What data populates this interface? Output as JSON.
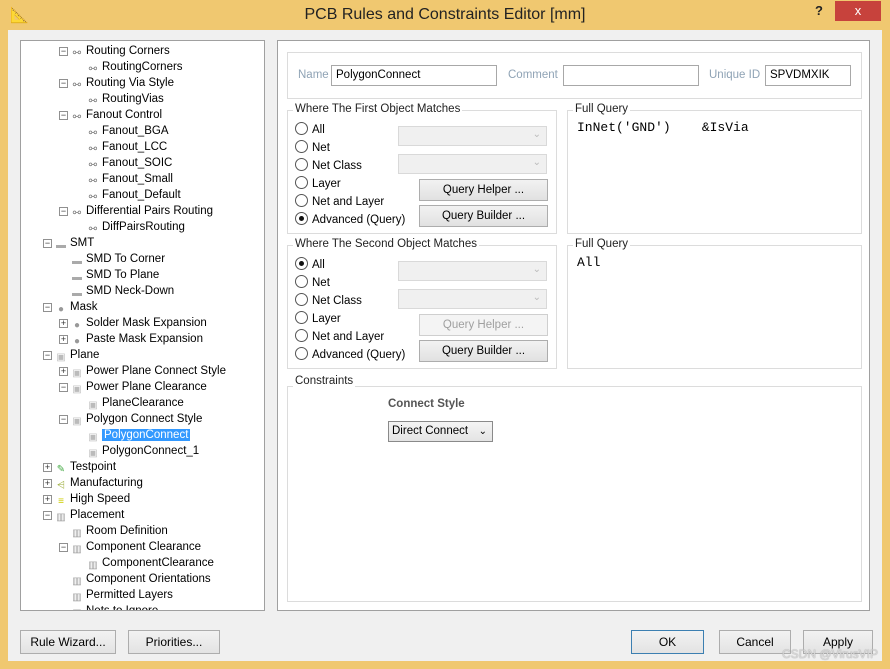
{
  "window": {
    "title": "PCB Rules and Constraints Editor [mm]",
    "help": "?",
    "close": "x"
  },
  "tree": [
    {
      "level": 2,
      "exp": "-",
      "icon": "routing",
      "label": "Routing Corners"
    },
    {
      "level": 3,
      "icon": "routing",
      "label": "RoutingCorners"
    },
    {
      "level": 2,
      "exp": "-",
      "icon": "routing",
      "label": "Routing Via Style"
    },
    {
      "level": 3,
      "icon": "routing",
      "label": "RoutingVias"
    },
    {
      "level": 2,
      "exp": "-",
      "icon": "routing",
      "label": "Fanout Control"
    },
    {
      "level": 3,
      "icon": "routing",
      "label": "Fanout_BGA"
    },
    {
      "level": 3,
      "icon": "routing",
      "label": "Fanout_LCC"
    },
    {
      "level": 3,
      "icon": "routing",
      "label": "Fanout_SOIC"
    },
    {
      "level": 3,
      "icon": "routing",
      "label": "Fanout_Small"
    },
    {
      "level": 3,
      "icon": "routing",
      "label": "Fanout_Default"
    },
    {
      "level": 2,
      "exp": "-",
      "icon": "routing",
      "label": "Differential Pairs Routing"
    },
    {
      "level": 3,
      "icon": "routing",
      "label": "DiffPairsRouting"
    },
    {
      "level": 1,
      "exp": "-",
      "icon": "smt",
      "label": "SMT"
    },
    {
      "level": 2,
      "icon": "smt",
      "label": "SMD To Corner"
    },
    {
      "level": 2,
      "icon": "smt",
      "label": "SMD To Plane"
    },
    {
      "level": 2,
      "icon": "smt",
      "label": "SMD Neck-Down"
    },
    {
      "level": 1,
      "exp": "-",
      "icon": "mask",
      "label": "Mask"
    },
    {
      "level": 2,
      "exp": "+",
      "icon": "mask",
      "label": "Solder Mask Expansion"
    },
    {
      "level": 2,
      "exp": "+",
      "icon": "mask",
      "label": "Paste Mask Expansion"
    },
    {
      "level": 1,
      "exp": "-",
      "icon": "plane",
      "label": "Plane"
    },
    {
      "level": 2,
      "exp": "+",
      "icon": "plane",
      "label": "Power Plane Connect Style"
    },
    {
      "level": 2,
      "exp": "-",
      "icon": "plane",
      "label": "Power Plane Clearance"
    },
    {
      "level": 3,
      "icon": "plane",
      "label": "PlaneClearance"
    },
    {
      "level": 2,
      "exp": "-",
      "icon": "plane",
      "label": "Polygon Connect Style"
    },
    {
      "level": 3,
      "icon": "plane",
      "label": "PolygonConnect",
      "selected": true
    },
    {
      "level": 3,
      "icon": "plane",
      "label": "PolygonConnect_1"
    },
    {
      "level": 1,
      "exp": "+",
      "icon": "testpoint",
      "label": "Testpoint"
    },
    {
      "level": 1,
      "exp": "+",
      "icon": "manufacturing",
      "label": "Manufacturing"
    },
    {
      "level": 1,
      "exp": "+",
      "icon": "high-speed",
      "label": "High Speed"
    },
    {
      "level": 1,
      "exp": "-",
      "icon": "placement",
      "label": "Placement"
    },
    {
      "level": 2,
      "icon": "placement",
      "label": "Room Definition"
    },
    {
      "level": 2,
      "exp": "-",
      "icon": "placement",
      "label": "Component Clearance"
    },
    {
      "level": 3,
      "icon": "placement",
      "label": "ComponentClearance"
    },
    {
      "level": 2,
      "icon": "placement",
      "label": "Component Orientations"
    },
    {
      "level": 2,
      "icon": "placement",
      "label": "Permitted Layers"
    },
    {
      "level": 2,
      "icon": "placement",
      "label": "Nets to Ignore"
    }
  ],
  "rule": {
    "name_label": "Name",
    "name": "PolygonConnect",
    "comment_label": "Comment",
    "comment": "",
    "uid_label": "Unique ID",
    "uid": "SPVDMXIK"
  },
  "first": {
    "title": "Where The First Object Matches",
    "options": [
      "All",
      "Net",
      "Net Class",
      "Layer",
      "Net and Layer",
      "Advanced (Query)"
    ],
    "selected": 5,
    "query_helper": "Query Helper ...",
    "query_builder": "Query Builder ...",
    "full_query_title": "Full Query",
    "full_query": "InNet('GND')    &IsVia"
  },
  "second": {
    "title": "Where The Second Object Matches",
    "options": [
      "All",
      "Net",
      "Net Class",
      "Layer",
      "Net and Layer",
      "Advanced (Query)"
    ],
    "selected": 0,
    "query_helper": "Query Helper ...",
    "query_builder": "Query Builder ...",
    "full_query_title": "Full Query",
    "full_query": "All"
  },
  "constraints": {
    "title": "Constraints",
    "connect_style_label": "Connect Style",
    "connect_style": "Direct Connect"
  },
  "footer": {
    "rule_wizard": "Rule Wizard...",
    "priorities": "Priorities...",
    "ok": "OK",
    "cancel": "Cancel",
    "apply": "Apply"
  },
  "watermark": "CSDN @VirusVIP"
}
